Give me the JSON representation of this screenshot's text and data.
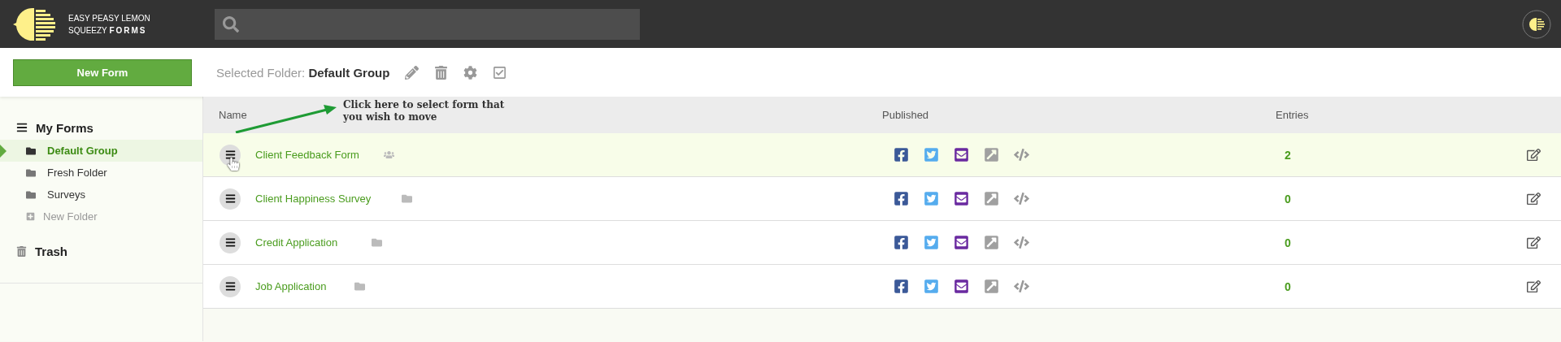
{
  "header": {
    "logo_line_1": "EASY PEASY LEMON",
    "logo_line_2": "SQUEEZY",
    "logo_bold": "FORMS"
  },
  "toolbar": {
    "new_form": "New Form",
    "selected_label": "Selected Folder:",
    "selected_value": "Default Group"
  },
  "sidebar": {
    "title": "My Forms",
    "folders": [
      {
        "label": "Default Group",
        "selected": true
      },
      {
        "label": "Fresh Folder",
        "selected": false
      },
      {
        "label": "Surveys",
        "selected": false
      }
    ],
    "new_folder": "New Folder",
    "trash": "Trash"
  },
  "table": {
    "columns": [
      "Name",
      "Published",
      "Entries"
    ],
    "annotation": "Click here to select form that you wish to move",
    "rows": [
      {
        "name": "Client Feedback Form",
        "kind": "group",
        "entries": "2",
        "selected": true
      },
      {
        "name": "Client Happiness Survey",
        "kind": "folder",
        "entries": "0",
        "selected": false
      },
      {
        "name": "Credit Application",
        "kind": "folder",
        "entries": "0",
        "selected": false
      },
      {
        "name": "Job Application",
        "kind": "folder",
        "entries": "0",
        "selected": false
      }
    ]
  }
}
